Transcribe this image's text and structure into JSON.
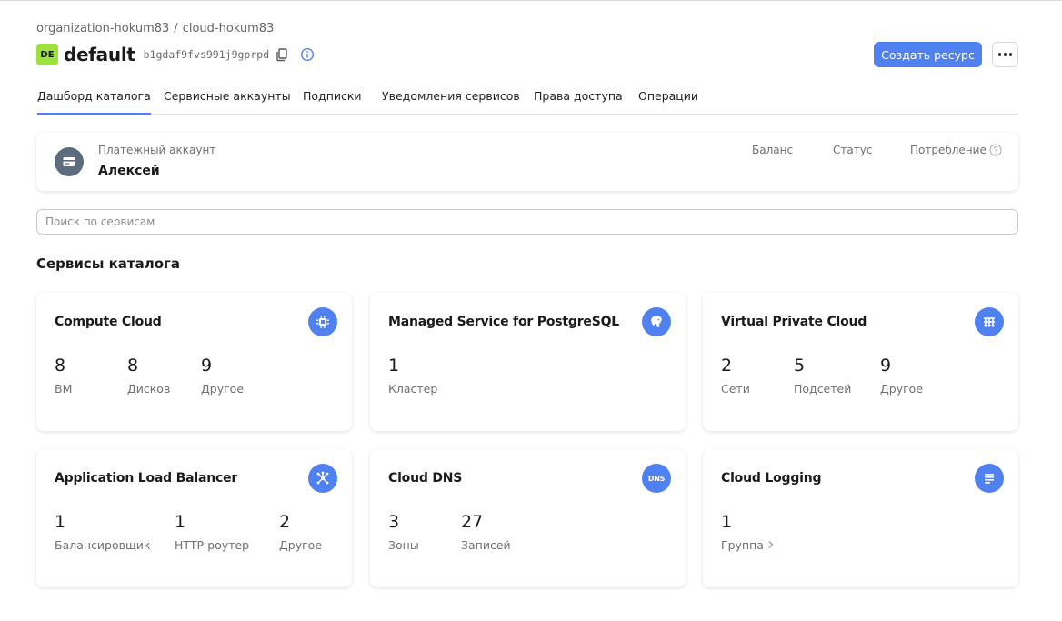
{
  "breadcrumb": {
    "organization": "organization-hokum83",
    "separator": "/",
    "cloud": "cloud-hokum83"
  },
  "folder": {
    "badge": "DE",
    "name": "default",
    "id": "b1gdaf9fvs991j9gprpd"
  },
  "header": {
    "create_button": "Создать ресурс",
    "more_icon": "more-dots-icon"
  },
  "tabs": [
    {
      "label": "Дашборд каталога",
      "active": true
    },
    {
      "label": "Сервисные аккаунты"
    },
    {
      "label": "Подписки"
    },
    {
      "label": "Уведомления сервисов"
    },
    {
      "label": "Права доступа"
    },
    {
      "label": "Операции"
    }
  ],
  "billing": {
    "label": "Платежный аккаунт",
    "name": "Алексей",
    "balance": "Баланс",
    "status": "Статус",
    "consumption": "Потребление",
    "icon": "credit-card-icon"
  },
  "search": {
    "placeholder": "Поиск по сервисам",
    "value": ""
  },
  "section_title": "Сервисы каталога",
  "colors": {
    "accent": "#4f81f1",
    "badge": "#9be23e",
    "billing_icon_bg": "#5d6b7e"
  },
  "services": [
    {
      "title": "Compute Cloud",
      "icon": "chip-icon",
      "stats": [
        {
          "value": "8",
          "label": "ВМ"
        },
        {
          "value": "8",
          "label": "Дисков"
        },
        {
          "value": "9",
          "label": "Другое"
        }
      ]
    },
    {
      "title": "Managed Service for PostgreSQL",
      "icon": "postgresql-icon",
      "stats": [
        {
          "value": "1",
          "label": "Кластер"
        }
      ]
    },
    {
      "title": "Virtual Private Cloud",
      "icon": "network-icon",
      "stats": [
        {
          "value": "2",
          "label": "Сети"
        },
        {
          "value": "5",
          "label": "Подсетей"
        },
        {
          "value": "9",
          "label": "Другое"
        }
      ]
    },
    {
      "title": "Application Load Balancer",
      "icon": "load-balancer-icon",
      "stats": [
        {
          "value": "1",
          "label": "Балансировщик"
        },
        {
          "value": "1",
          "label": "HTTP-роутер"
        },
        {
          "value": "2",
          "label": "Другое"
        }
      ]
    },
    {
      "title": "Cloud DNS",
      "icon": "dns-icon",
      "icon_text": "DNS",
      "stats": [
        {
          "value": "3",
          "label": "Зоны"
        },
        {
          "value": "27",
          "label": "Записей"
        }
      ]
    },
    {
      "title": "Cloud Logging",
      "icon": "log-lines-icon",
      "stats": [
        {
          "value": "1",
          "label": "Группа",
          "link": true
        }
      ]
    }
  ]
}
